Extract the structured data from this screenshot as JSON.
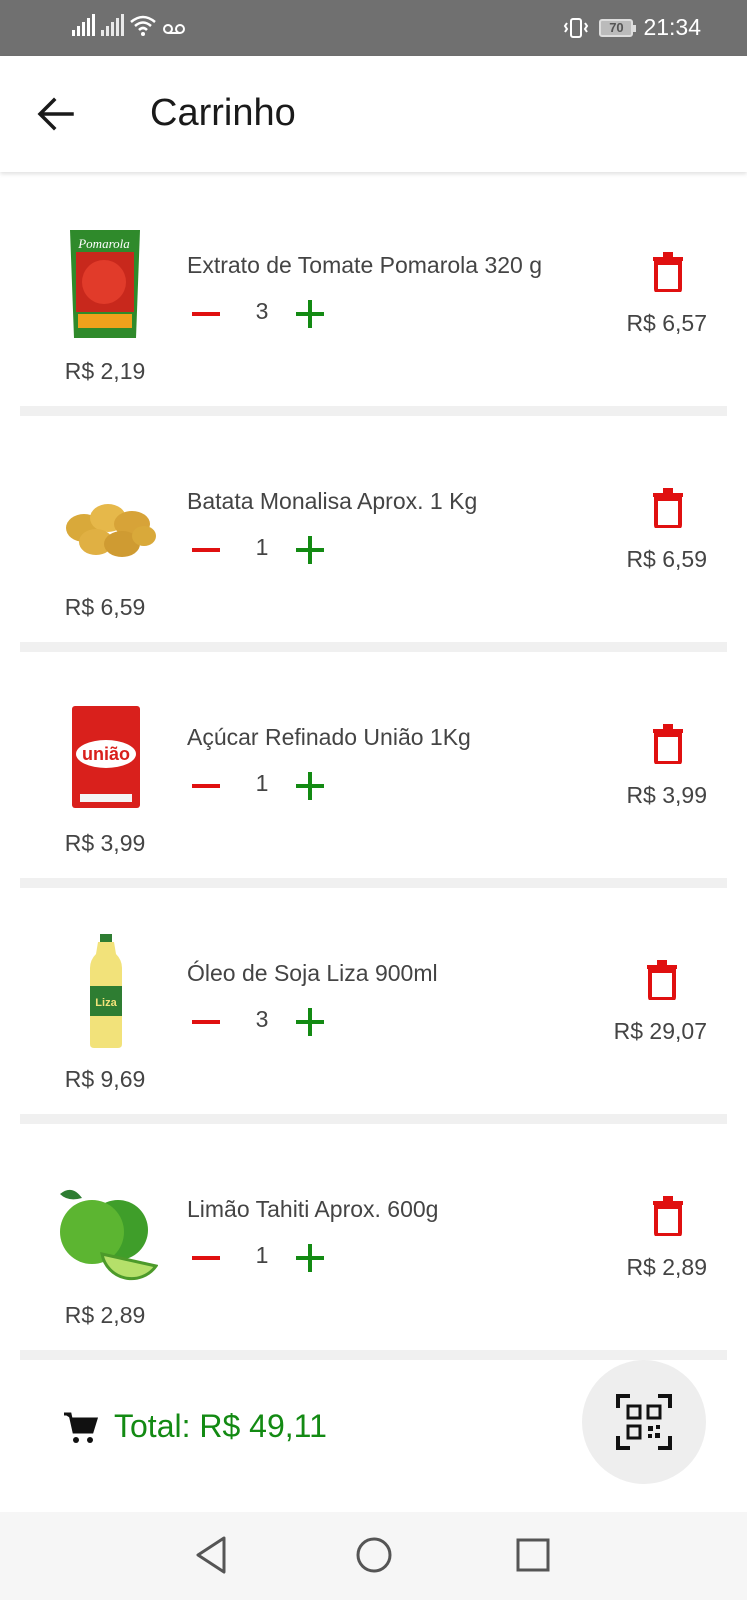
{
  "status_bar": {
    "time": "21:34",
    "battery": "70"
  },
  "header": {
    "title": "Carrinho"
  },
  "items": [
    {
      "name": "Extrato de Tomate Pomarola 320 g",
      "qty": "3",
      "unit_price": "R$ 2,19",
      "total": "R$ 6,57",
      "image": "tomato-paste-pouch"
    },
    {
      "name": "Batata Monalisa Aprox. 1 Kg",
      "qty": "1",
      "unit_price": "R$ 6,59",
      "total": "R$ 6,59",
      "image": "potatoes"
    },
    {
      "name": "Açúcar Refinado União 1Kg",
      "qty": "1",
      "unit_price": "R$ 3,99",
      "total": "R$ 3,99",
      "image": "sugar-bag"
    },
    {
      "name": "Óleo de Soja Liza 900ml",
      "qty": "3",
      "unit_price": "R$ 9,69",
      "total": "R$ 29,07",
      "image": "oil-bottle"
    },
    {
      "name": "Limão Tahiti Aprox. 600g",
      "qty": "1",
      "unit_price": "R$ 2,89",
      "total": "R$ 2,89",
      "image": "limes"
    }
  ],
  "footer": {
    "total_label": "Total: R$ 49,11"
  },
  "colors": {
    "accent_green": "#138a13",
    "delete_red": "#e01010",
    "status_bar": "#707070"
  },
  "icons": [
    "back-arrow-icon",
    "trash-icon",
    "minus-icon",
    "plus-icon",
    "cart-icon",
    "qr-code-icon",
    "nav-back-icon",
    "nav-home-icon",
    "nav-recents-icon"
  ]
}
